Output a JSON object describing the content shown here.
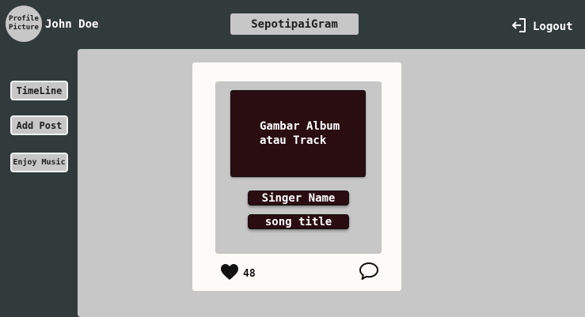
{
  "header": {
    "avatar_text": "Profile Picture",
    "username": "John Doe",
    "app_title": "SepotipaiGram",
    "logout_label": "Logout"
  },
  "sidebar": {
    "items": [
      {
        "label": "TimeLine"
      },
      {
        "label": "Add Post"
      },
      {
        "label": "Enjoy Music"
      }
    ]
  },
  "post": {
    "album_placeholder": "Gambar Album\natau Track",
    "singer": "Singer Name",
    "song_title": "song title",
    "like_count": "48",
    "icons": {
      "like": "heart-icon",
      "comment": "comment-icon",
      "logout": "logout-icon"
    }
  },
  "colors": {
    "background": "#323b3b",
    "panel": "#c7c7c7",
    "card": "#fdfbfa",
    "album": "#2a0d11"
  }
}
